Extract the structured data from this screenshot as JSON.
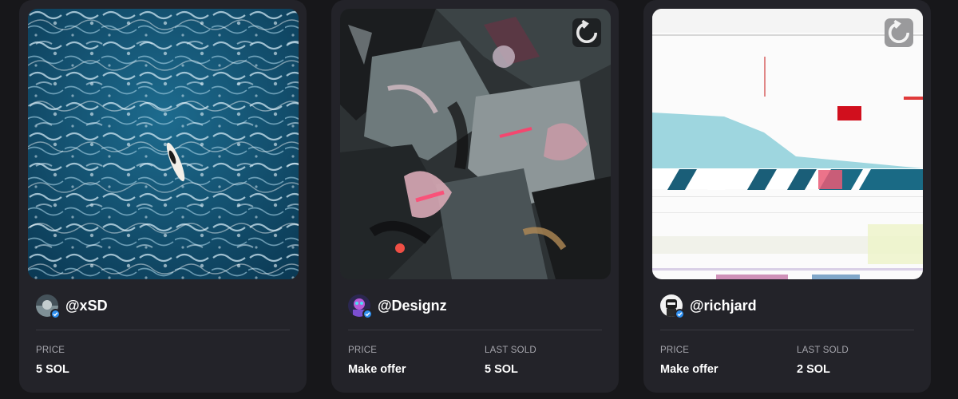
{
  "cards": [
    {
      "creator": "@xSD",
      "price_label": "PRICE",
      "price_value": "5 SOL",
      "image_icon": "ocean-surfer-artwork"
    },
    {
      "creator": "@Designz",
      "price_label": "PRICE",
      "price_value": "Make offer",
      "last_sold_label": "LAST SOLD",
      "last_sold_value": "5 SOL",
      "image_icon": "abstract-paint-artwork"
    },
    {
      "creator": "@richjard",
      "price_label": "PRICE",
      "price_value": "Make offer",
      "last_sold_label": "LAST SOLD",
      "last_sold_value": "2 SOL",
      "image_icon": "glitch-artwork"
    }
  ],
  "icons": {
    "refresh": "refresh-icon",
    "verified": "verified-badge-icon"
  },
  "colors": {
    "background": "#17171a",
    "card": "#232329",
    "muted_text": "#a6a6ad",
    "verified": "#2e8ff0"
  }
}
